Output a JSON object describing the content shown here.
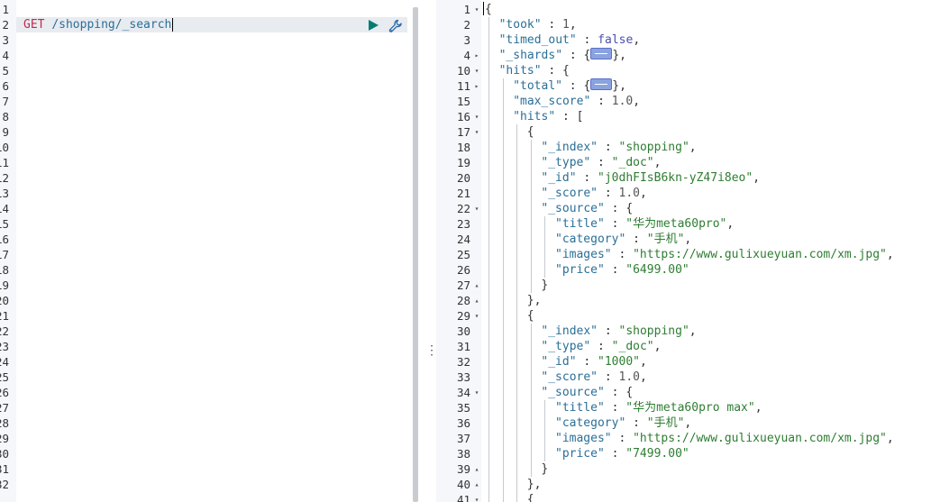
{
  "request_editor": {
    "line_numbers": [
      "1",
      "2",
      "3",
      "4",
      "5",
      "6",
      "7",
      "8",
      "9",
      "10",
      "11",
      "12",
      "13",
      "14",
      "15",
      "16",
      "17",
      "18",
      "19",
      "20",
      "21",
      "22",
      "23",
      "24",
      "25",
      "26",
      "27",
      "28",
      "29",
      "30",
      "31",
      "32"
    ],
    "method": "GET",
    "path": "/shopping/_search",
    "run_icon": "play-icon",
    "settings_icon": "wrench-icon"
  },
  "divider": {
    "handle_glyph": "⋮"
  },
  "response_editor": {
    "lines": [
      {
        "num": "1",
        "fold": "down",
        "indent": 0,
        "parts": [
          [
            "p",
            "{"
          ]
        ]
      },
      {
        "num": "2",
        "fold": "",
        "indent": 1,
        "parts": [
          [
            "k",
            "\"took\""
          ],
          [
            "p",
            " : "
          ],
          [
            "n",
            "1"
          ],
          [
            "p",
            ","
          ]
        ]
      },
      {
        "num": "3",
        "fold": "",
        "indent": 1,
        "parts": [
          [
            "k",
            "\"timed_out\""
          ],
          [
            "p",
            " : "
          ],
          [
            "b",
            "false"
          ],
          [
            "p",
            ","
          ]
        ]
      },
      {
        "num": "4",
        "fold": "right",
        "indent": 1,
        "parts": [
          [
            "k",
            "\"_shards\""
          ],
          [
            "p",
            " : {"
          ],
          [
            "w",
            ""
          ],
          [
            "p",
            "},"
          ]
        ]
      },
      {
        "num": "10",
        "fold": "down",
        "indent": 1,
        "parts": [
          [
            "k",
            "\"hits\""
          ],
          [
            "p",
            " : {"
          ]
        ]
      },
      {
        "num": "11",
        "fold": "right",
        "indent": 2,
        "parts": [
          [
            "k",
            "\"total\""
          ],
          [
            "p",
            " : {"
          ],
          [
            "w",
            ""
          ],
          [
            "p",
            "},"
          ]
        ]
      },
      {
        "num": "15",
        "fold": "",
        "indent": 2,
        "parts": [
          [
            "k",
            "\"max_score\""
          ],
          [
            "p",
            " : "
          ],
          [
            "n",
            "1.0"
          ],
          [
            "p",
            ","
          ]
        ]
      },
      {
        "num": "16",
        "fold": "down",
        "indent": 2,
        "parts": [
          [
            "k",
            "\"hits\""
          ],
          [
            "p",
            " : ["
          ]
        ]
      },
      {
        "num": "17",
        "fold": "down",
        "indent": 3,
        "parts": [
          [
            "p",
            "{"
          ]
        ]
      },
      {
        "num": "18",
        "fold": "",
        "indent": 4,
        "parts": [
          [
            "k",
            "\"_index\""
          ],
          [
            "p",
            " : "
          ],
          [
            "s",
            "\"shopping\""
          ],
          [
            "p",
            ","
          ]
        ]
      },
      {
        "num": "19",
        "fold": "",
        "indent": 4,
        "parts": [
          [
            "k",
            "\"_type\""
          ],
          [
            "p",
            " : "
          ],
          [
            "s",
            "\"_doc\""
          ],
          [
            "p",
            ","
          ]
        ]
      },
      {
        "num": "20",
        "fold": "",
        "indent": 4,
        "parts": [
          [
            "k",
            "\"_id\""
          ],
          [
            "p",
            " : "
          ],
          [
            "s",
            "\"j0dhFIsB6kn-yZ47i8eo\""
          ],
          [
            "p",
            ","
          ]
        ]
      },
      {
        "num": "21",
        "fold": "",
        "indent": 4,
        "parts": [
          [
            "k",
            "\"_score\""
          ],
          [
            "p",
            " : "
          ],
          [
            "n",
            "1.0"
          ],
          [
            "p",
            ","
          ]
        ]
      },
      {
        "num": "22",
        "fold": "down",
        "indent": 4,
        "parts": [
          [
            "k",
            "\"_source\""
          ],
          [
            "p",
            " : {"
          ]
        ]
      },
      {
        "num": "23",
        "fold": "",
        "indent": 5,
        "parts": [
          [
            "k",
            "\"title\""
          ],
          [
            "p",
            " : "
          ],
          [
            "s",
            "\"华为meta60pro\""
          ],
          [
            "p",
            ","
          ]
        ]
      },
      {
        "num": "24",
        "fold": "",
        "indent": 5,
        "parts": [
          [
            "k",
            "\"category\""
          ],
          [
            "p",
            " : "
          ],
          [
            "s",
            "\"手机\""
          ],
          [
            "p",
            ","
          ]
        ]
      },
      {
        "num": "25",
        "fold": "",
        "indent": 5,
        "parts": [
          [
            "k",
            "\"images\""
          ],
          [
            "p",
            " : "
          ],
          [
            "s",
            "\"https://www.gulixueyuan.com/xm.jpg\""
          ],
          [
            "p",
            ","
          ]
        ]
      },
      {
        "num": "26",
        "fold": "",
        "indent": 5,
        "parts": [
          [
            "k",
            "\"price\""
          ],
          [
            "p",
            " : "
          ],
          [
            "s",
            "\"6499.00\""
          ]
        ]
      },
      {
        "num": "27",
        "fold": "up",
        "indent": 4,
        "parts": [
          [
            "p",
            "}"
          ]
        ]
      },
      {
        "num": "28",
        "fold": "up",
        "indent": 3,
        "parts": [
          [
            "p",
            "},"
          ]
        ]
      },
      {
        "num": "29",
        "fold": "down",
        "indent": 3,
        "parts": [
          [
            "p",
            "{"
          ]
        ]
      },
      {
        "num": "30",
        "fold": "",
        "indent": 4,
        "parts": [
          [
            "k",
            "\"_index\""
          ],
          [
            "p",
            " : "
          ],
          [
            "s",
            "\"shopping\""
          ],
          [
            "p",
            ","
          ]
        ]
      },
      {
        "num": "31",
        "fold": "",
        "indent": 4,
        "parts": [
          [
            "k",
            "\"_type\""
          ],
          [
            "p",
            " : "
          ],
          [
            "s",
            "\"_doc\""
          ],
          [
            "p",
            ","
          ]
        ]
      },
      {
        "num": "32",
        "fold": "",
        "indent": 4,
        "parts": [
          [
            "k",
            "\"_id\""
          ],
          [
            "p",
            " : "
          ],
          [
            "s",
            "\"1000\""
          ],
          [
            "p",
            ","
          ]
        ]
      },
      {
        "num": "33",
        "fold": "",
        "indent": 4,
        "parts": [
          [
            "k",
            "\"_score\""
          ],
          [
            "p",
            " : "
          ],
          [
            "n",
            "1.0"
          ],
          [
            "p",
            ","
          ]
        ]
      },
      {
        "num": "34",
        "fold": "down",
        "indent": 4,
        "parts": [
          [
            "k",
            "\"_source\""
          ],
          [
            "p",
            " : {"
          ]
        ]
      },
      {
        "num": "35",
        "fold": "",
        "indent": 5,
        "parts": [
          [
            "k",
            "\"title\""
          ],
          [
            "p",
            " : "
          ],
          [
            "s",
            "\"华为meta60pro max\""
          ],
          [
            "p",
            ","
          ]
        ]
      },
      {
        "num": "36",
        "fold": "",
        "indent": 5,
        "parts": [
          [
            "k",
            "\"category\""
          ],
          [
            "p",
            " : "
          ],
          [
            "s",
            "\"手机\""
          ],
          [
            "p",
            ","
          ]
        ]
      },
      {
        "num": "37",
        "fold": "",
        "indent": 5,
        "parts": [
          [
            "k",
            "\"images\""
          ],
          [
            "p",
            " : "
          ],
          [
            "s",
            "\"https://www.gulixueyuan.com/xm.jpg\""
          ],
          [
            "p",
            ","
          ]
        ]
      },
      {
        "num": "38",
        "fold": "",
        "indent": 5,
        "parts": [
          [
            "k",
            "\"price\""
          ],
          [
            "p",
            " : "
          ],
          [
            "s",
            "\"7499.00\""
          ]
        ]
      },
      {
        "num": "39",
        "fold": "up",
        "indent": 4,
        "parts": [
          [
            "p",
            "}"
          ]
        ]
      },
      {
        "num": "40",
        "fold": "up",
        "indent": 3,
        "parts": [
          [
            "p",
            "},"
          ]
        ]
      },
      {
        "num": "41",
        "fold": "down",
        "indent": 3,
        "parts": [
          [
            "p",
            "{"
          ]
        ]
      }
    ]
  }
}
